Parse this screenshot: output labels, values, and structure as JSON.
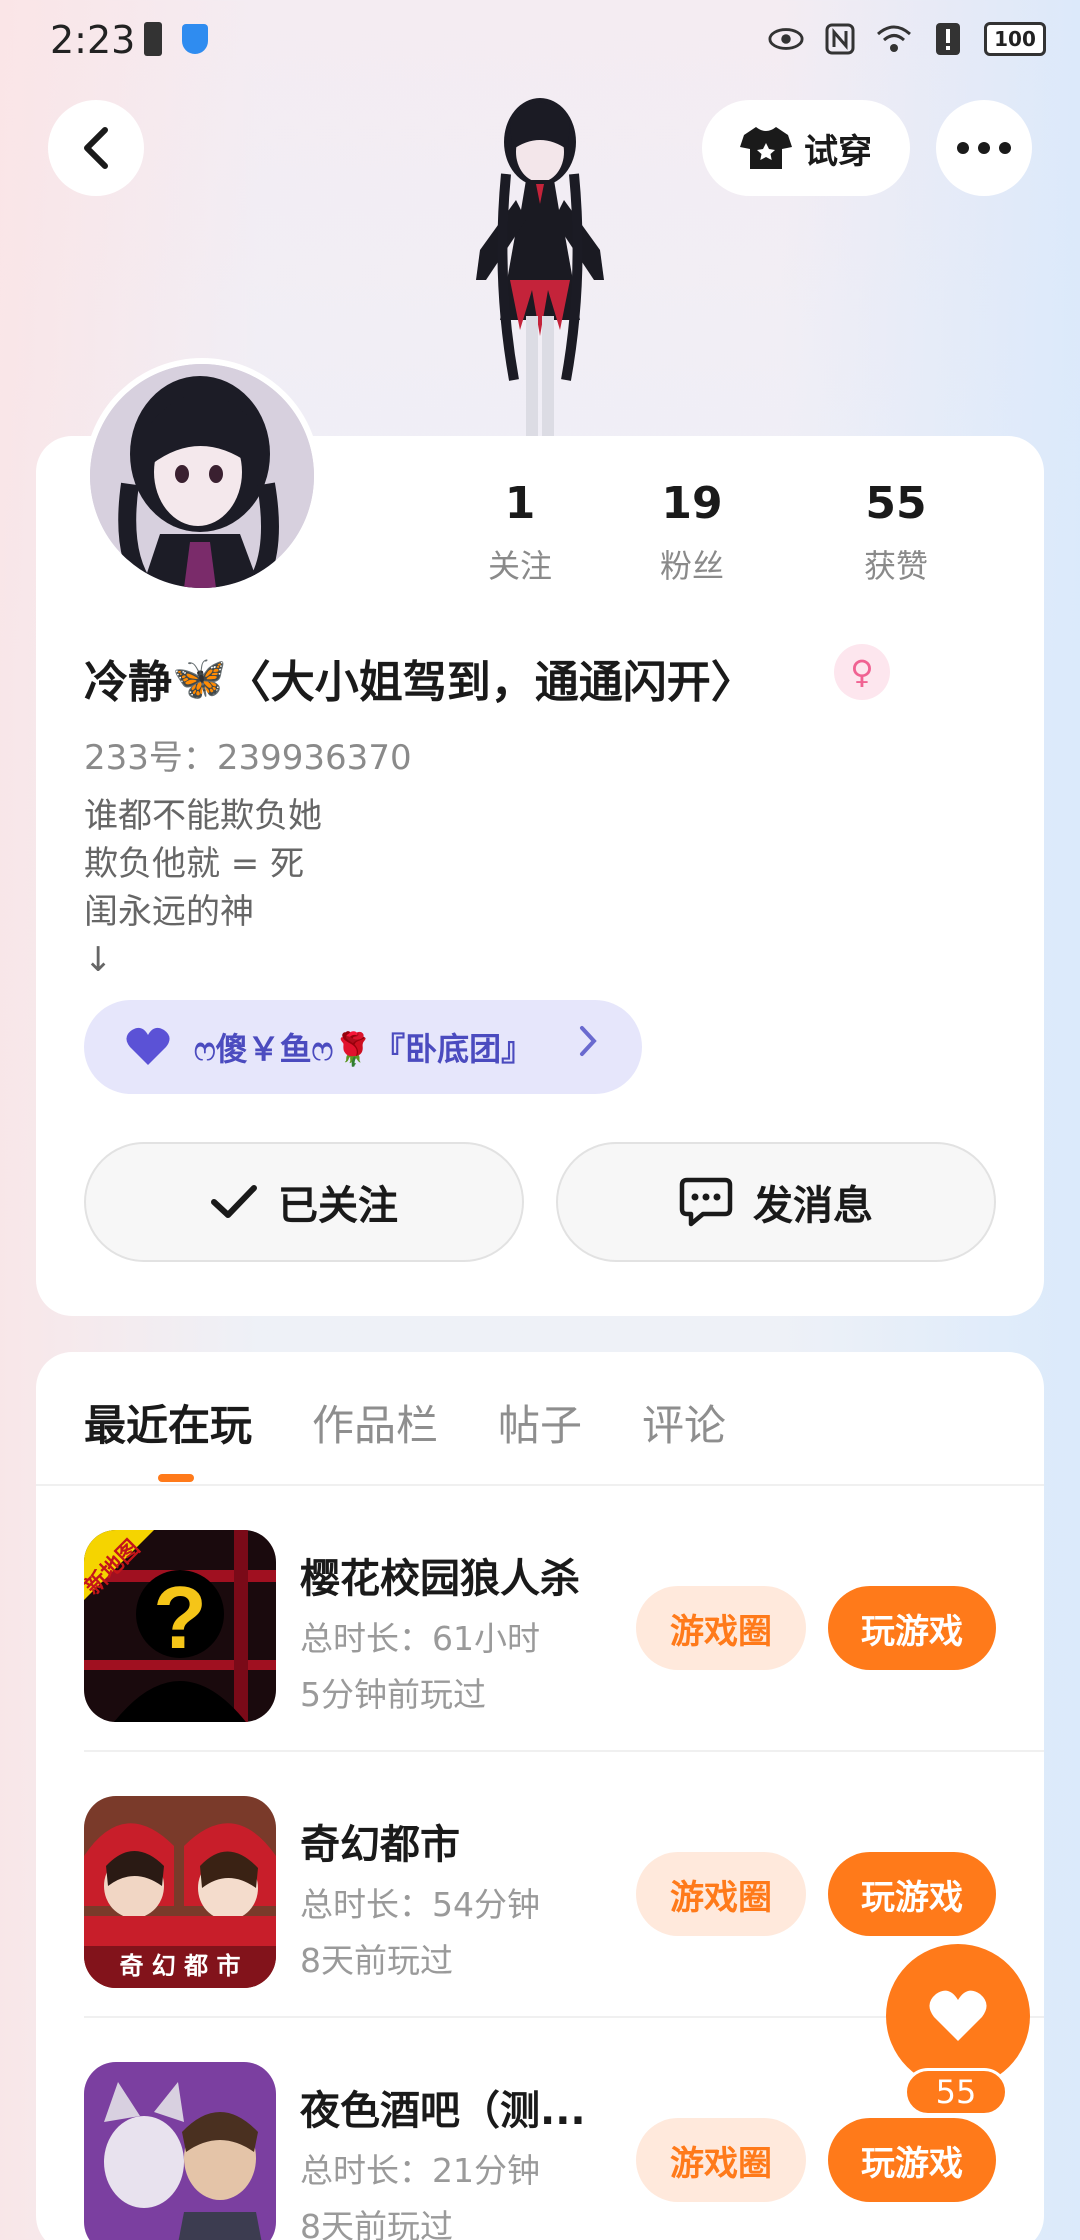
{
  "status_bar": {
    "time": "2:23",
    "battery": "100"
  },
  "header": {
    "try_on_label": "试穿",
    "back_icon": "back-arrow-icon",
    "more_icon": "more-dots-icon"
  },
  "profile": {
    "stats": [
      {
        "value": "1",
        "label": "关注"
      },
      {
        "value": "19",
        "label": "粉丝"
      },
      {
        "value": "55",
        "label": "获赞"
      }
    ],
    "name_part1": "冷静",
    "name_emoji": "🦋",
    "name_part2": "〈大小姐驾到，通通闪开〉",
    "gender_symbol": "♀",
    "uid": "233号：239936370",
    "bio_lines": [
      "谁都不能欺负她",
      "欺负他就 = 死",
      "闺永远的神",
      "↓"
    ],
    "group_name": "ෆ傻￥鱼ෆ🌹『卧底团』",
    "follow_label": "已关注",
    "message_label": "发消息"
  },
  "tabs": [
    "最近在玩",
    "作品栏",
    "帖子",
    "评论"
  ],
  "games": [
    {
      "title": "樱花校园狼人杀",
      "duration": "总时长：61小时",
      "last_played": "5分钟前玩过",
      "badge": "新地图",
      "circle_label": "游戏圈",
      "play_label": "玩游戏"
    },
    {
      "title": "奇幻都市",
      "duration": "总时长：54分钟",
      "last_played": "8天前玩过",
      "badge": "奇 幻 都 市",
      "circle_label": "游戏圈",
      "play_label": "玩游戏"
    },
    {
      "title": "夜色酒吧（测...",
      "duration": "总时长：21分钟",
      "last_played": "8天前玩过",
      "circle_label": "游戏圈",
      "play_label": "玩游戏"
    }
  ],
  "like_fab": {
    "count": "55"
  },
  "colors": {
    "accent": "#ff7a1a",
    "accent_soft": "#ffe9dc",
    "group_bg": "#e6e6fb",
    "group_text": "#4b4bbf"
  }
}
